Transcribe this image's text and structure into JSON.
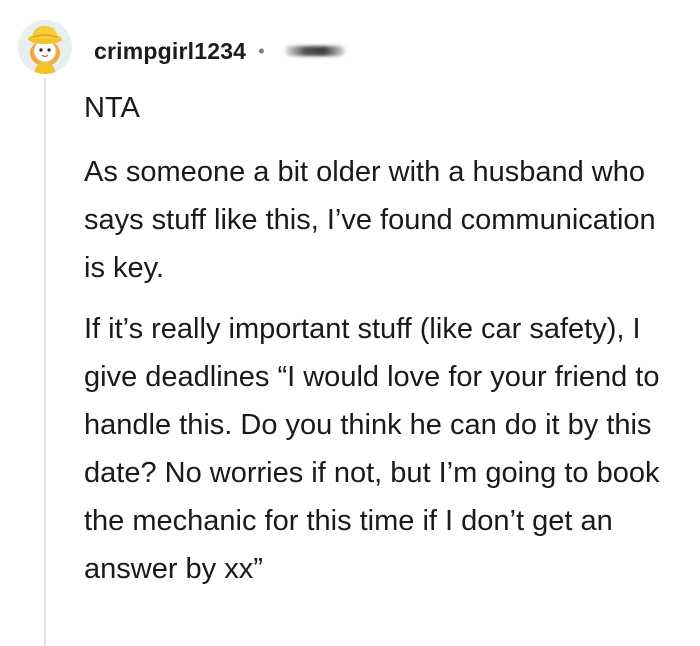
{
  "comment": {
    "username": "crimpgirl1234",
    "separator": "•",
    "paragraphs": [
      "NTA",
      "As someone a bit older with a husband who says stuff like this, I’ve found communication is key.",
      "If it’s really important stuff (like car safety), I give deadlines “I would love for your friend to handle this. Do you think he can do it by this date? No worries if not, but I’m going to book the mechanic for this time if I don’t get an answer by xx”"
    ]
  },
  "colors": {
    "text": "#1a1a1a",
    "thread_line": "#e4e4e4",
    "avatar_hat": "#f3c12a"
  },
  "icons": {
    "avatar": "user-avatar-yellow-hat",
    "timestamp": "blurred-timestamp"
  }
}
